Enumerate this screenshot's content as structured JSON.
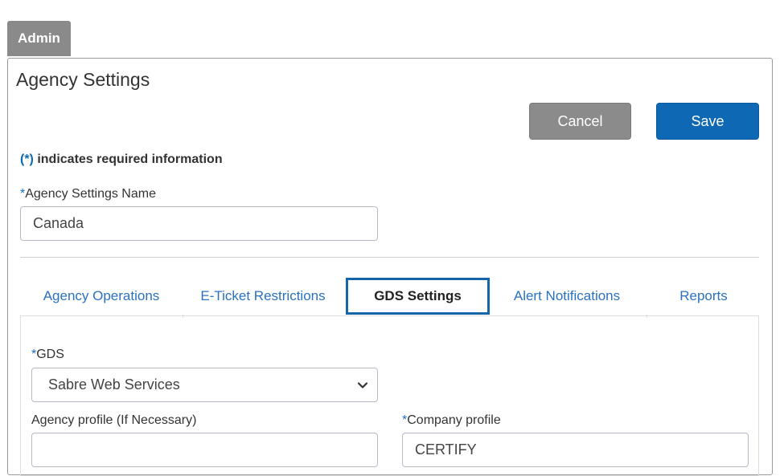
{
  "admin_tab": {
    "label": "Admin"
  },
  "page": {
    "title": "Agency Settings"
  },
  "actions": {
    "cancel_label": "Cancel",
    "save_label": "Save"
  },
  "required_note": {
    "star": "(*)",
    "text": " indicates required information"
  },
  "agency_settings_name": {
    "star": "*",
    "label": "Agency Settings Name",
    "value": "Canada"
  },
  "tabs": [
    {
      "label": "Agency Operations",
      "active": false
    },
    {
      "label": "E-Ticket Restrictions",
      "active": false
    },
    {
      "label": "GDS Settings",
      "active": true
    },
    {
      "label": "Alert Notifications",
      "active": false
    },
    {
      "label": "Reports",
      "active": false
    }
  ],
  "gds": {
    "star": "*",
    "label": "GDS",
    "selected": "Sabre Web Services"
  },
  "agency_profile": {
    "label": "Agency profile (If Necessary)",
    "value": ""
  },
  "company_profile": {
    "star": "*",
    "label": "Company profile",
    "value": "CERTIFY"
  },
  "colors": {
    "accent": "#0f68b4",
    "cancel": "#8b8b8b",
    "admin_tab": "#8a8a8a",
    "link": "#2a72bf"
  }
}
